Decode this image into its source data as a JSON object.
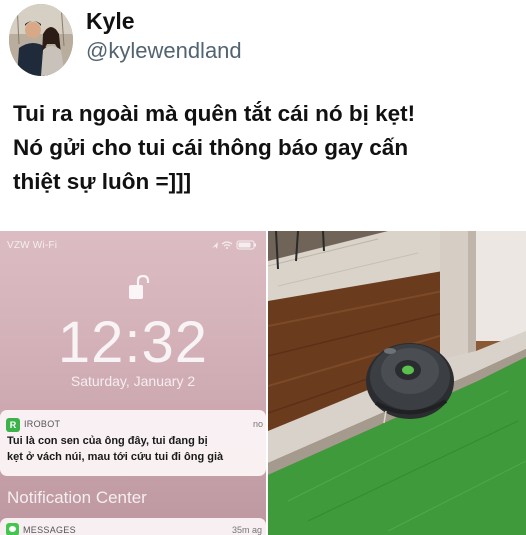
{
  "author": {
    "name": "Kyle",
    "handle": "@kylewendland"
  },
  "tweet": {
    "lines": [
      "Tui ra ngoài mà quên tắt cái nó bị kẹt!",
      "Nó gửi cho tui cái thông báo gay cấn",
      "thiệt sự luôn =]]]"
    ]
  },
  "lock_screen": {
    "carrier": "VZW Wi-Fi",
    "time": "12:32",
    "date": "Saturday, January 2",
    "notification": {
      "app_icon_letter": "R",
      "app": "IROBOT",
      "time": "no",
      "lines": [
        "Tui là con sen của ông đây, tui đang bị",
        "kẹt ở vách núi, mau tới cứu tui đi ông già"
      ]
    },
    "notification_center_label": "Notification Center",
    "messages": {
      "app": "MESSAGES",
      "time": "35m ag"
    }
  },
  "colors": {
    "lock_bg": "#d3b0b8",
    "irobot_green": "#3cb34a",
    "rug_green": "#3f9a3c",
    "floor_wood": "#6b3b1e"
  }
}
